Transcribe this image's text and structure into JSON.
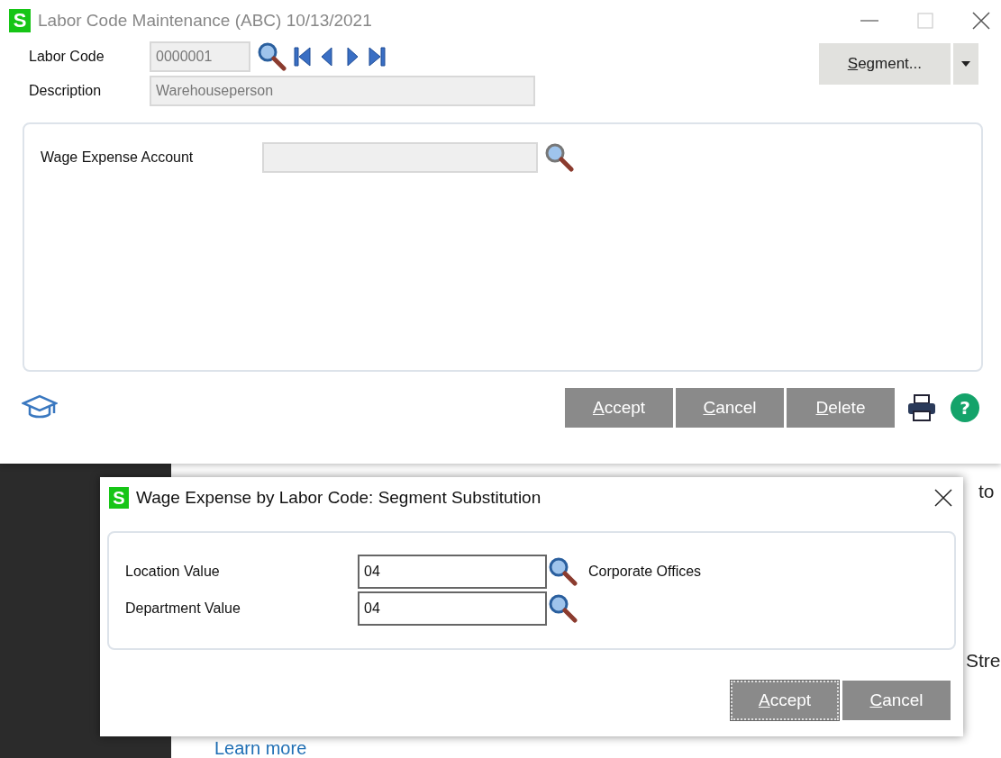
{
  "window": {
    "logo": "S",
    "title": "Labor Code Maintenance (ABC) 10/13/2021",
    "maximize_disabled": true
  },
  "header": {
    "fields": [
      {
        "label": "Labor Code",
        "value": "0000001",
        "kind": "lookup"
      },
      {
        "label": "Description",
        "value": "Warehouseperson",
        "kind": "text"
      }
    ],
    "segment_button": "Segment..."
  },
  "panel": {
    "fields": [
      {
        "label": "Wage Expense Account"
      }
    ]
  },
  "footer": {
    "buttons": [
      "Accept",
      "Cancel",
      "Delete"
    ],
    "help": "?"
  },
  "background_page": {
    "texts": [
      "to",
      "Stre"
    ],
    "link": "Learn more"
  },
  "dialog": {
    "logo": "S",
    "title": "Wage Expense by Labor Code: Segment Substitution",
    "fields": [
      {
        "label": "Location Value",
        "value": "04",
        "description": "Corporate Offices"
      },
      {
        "label": "Department Value",
        "value": "04"
      }
    ],
    "buttons": [
      {
        "label": "Accept",
        "focused": true
      },
      {
        "label": "Cancel",
        "focused": false
      }
    ]
  }
}
